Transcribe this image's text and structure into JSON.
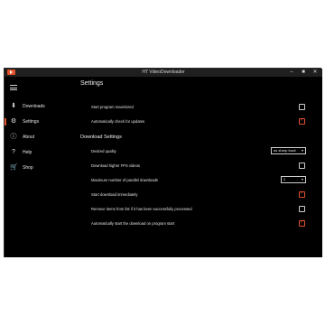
{
  "window": {
    "title": "HT VideoDownloader"
  },
  "sidebar": {
    "items": [
      {
        "label": "Downloads",
        "icon": "download-icon"
      },
      {
        "label": "Settings",
        "icon": "gear-icon",
        "active": true
      },
      {
        "label": "About",
        "icon": "info-icon"
      },
      {
        "label": "Help",
        "icon": "help-icon"
      },
      {
        "label": "Shop",
        "icon": "cart-icon"
      }
    ]
  },
  "main": {
    "title": "Settings",
    "general": [
      {
        "label": "Start program maximized",
        "checked": false
      },
      {
        "label": "Automatically check for updates",
        "checked": true
      }
    ],
    "download_section_title": "Download Settings",
    "quality": {
      "label": "Desired quality",
      "value": "as sharp kwal"
    },
    "higher_fps": {
      "label": "Download higher FPS videos",
      "checked": false
    },
    "parallel": {
      "label": "Maximum number of parallel downloads",
      "value": "2"
    },
    "start_immediately": {
      "label": "Start download immediately",
      "checked": true
    },
    "remove_items": {
      "label": "Remove items from list if it has been successfully processed",
      "checked": false
    },
    "auto_start": {
      "label": "Automatically start the download on program start",
      "checked": true
    }
  },
  "colors": {
    "accent": "#e0532c",
    "background": "#000000",
    "titlebar": "#1f1f1f"
  }
}
